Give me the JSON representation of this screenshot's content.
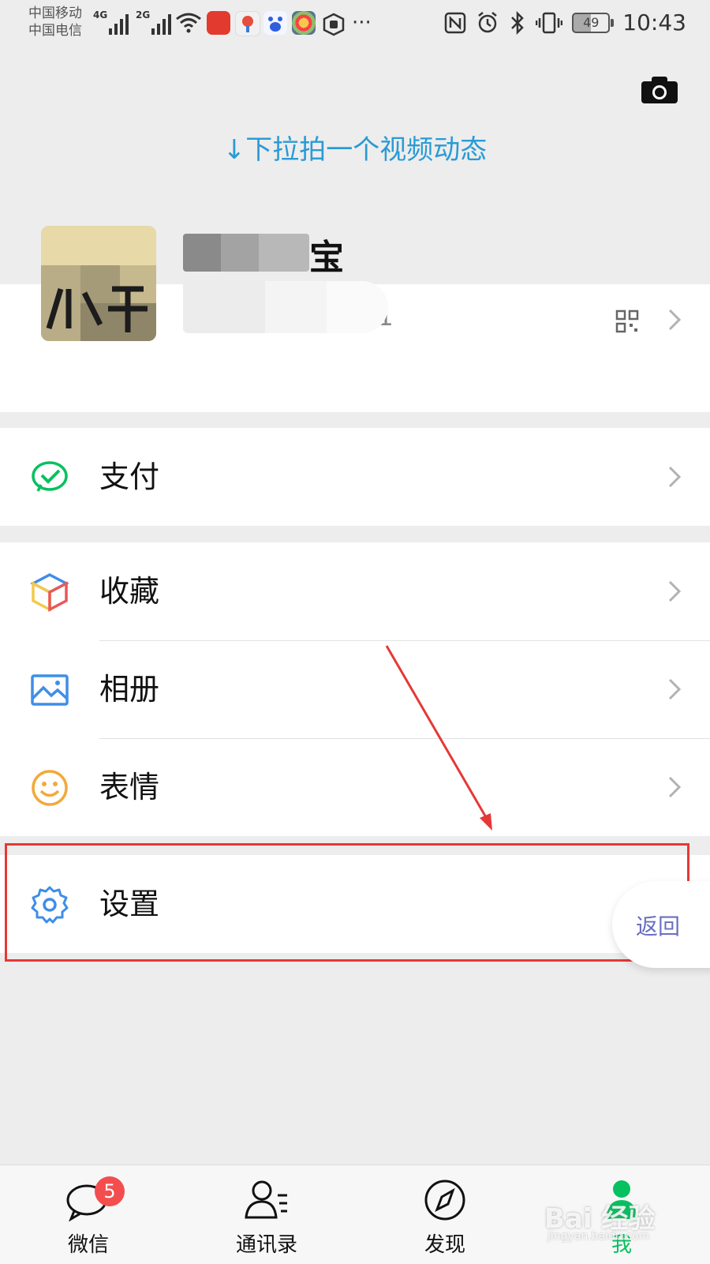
{
  "status_bar": {
    "carrier_1": "中国移动",
    "carrier_2": "中国电信",
    "network_1": "4G",
    "network_2": "2G",
    "battery": "49",
    "time": "10:43"
  },
  "header": {
    "pull_hint": "↓下拉拍一个视频动态"
  },
  "profile": {
    "nickname_visible": "宝",
    "id_visible": "01"
  },
  "menu": {
    "pay": "支付",
    "favorites": "收藏",
    "album": "相册",
    "stickers": "表情",
    "settings": "设置"
  },
  "overlay": {
    "back_label": "返回"
  },
  "tabs": [
    {
      "label": "微信",
      "badge": "5"
    },
    {
      "label": "通讯录"
    },
    {
      "label": "发现"
    },
    {
      "label": "我"
    }
  ],
  "watermark": {
    "text": "Bai 经验",
    "sub": "jingyan.baidu.com"
  },
  "colors": {
    "accent_green": "#07c160",
    "annotation_red": "#e53935",
    "hint_blue": "#2a9bd5",
    "badge_red": "#f34d4d"
  }
}
